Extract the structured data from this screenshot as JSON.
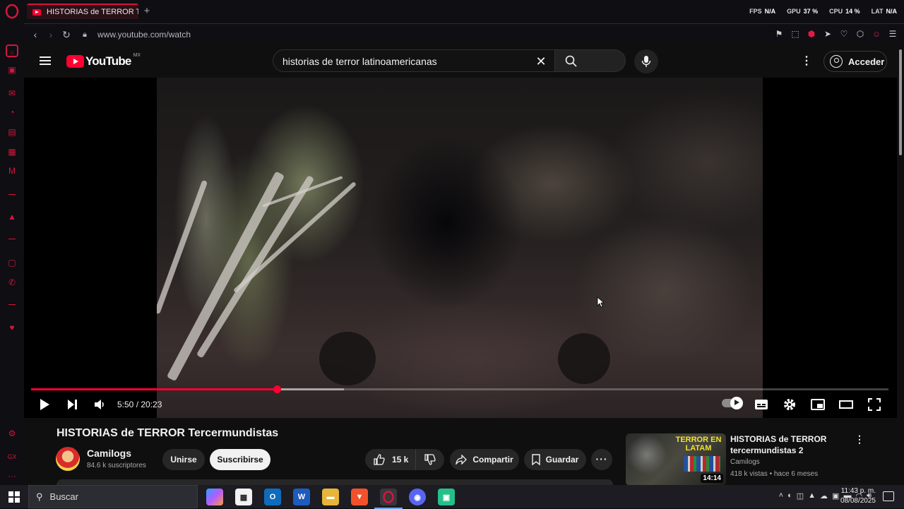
{
  "browser": {
    "tab_title": "HISTORIAS de TERROR Te",
    "new_tab": "+",
    "url": "www.youtube.com/watch",
    "stats": [
      {
        "label": "FPS",
        "value": "N/A"
      },
      {
        "label": "GPU",
        "value": "37 %"
      },
      {
        "label": "CPU",
        "value": "14 %"
      },
      {
        "label": "LAT",
        "value": "N/A"
      }
    ],
    "accent_color": "#d6153a"
  },
  "youtube": {
    "logo_text": "YouTube",
    "country_code": "MX",
    "search_query": "historias de terror latinoamericanas",
    "signin_label": "Acceder"
  },
  "player": {
    "current_time": "5:50",
    "duration": "20:23",
    "time_display": "5:50 / 20:23",
    "progress_fraction": 0.287,
    "buffer_fraction": 0.365
  },
  "video": {
    "title": "HISTORIAS de TERROR Tercermundistas",
    "channel": "Camilogs",
    "subscribers": "84.6 k suscriptores",
    "join_label": "Unirse",
    "subscribe_label": "Suscribirse",
    "likes": "15 k",
    "share_label": "Compartir",
    "save_label": "Guardar",
    "more_label": "···"
  },
  "recommended": [
    {
      "title": "HISTORIAS de TERROR tercermundistas 2",
      "channel": "Camilogs",
      "meta": "418 k vistas • hace 6 meses",
      "duration": "14:14",
      "thumb_text": "TERROR EN LATAM"
    }
  ],
  "taskbar": {
    "search_placeholder": "Buscar",
    "time": "11:43 p. m.",
    "date": "08/08/2025"
  }
}
